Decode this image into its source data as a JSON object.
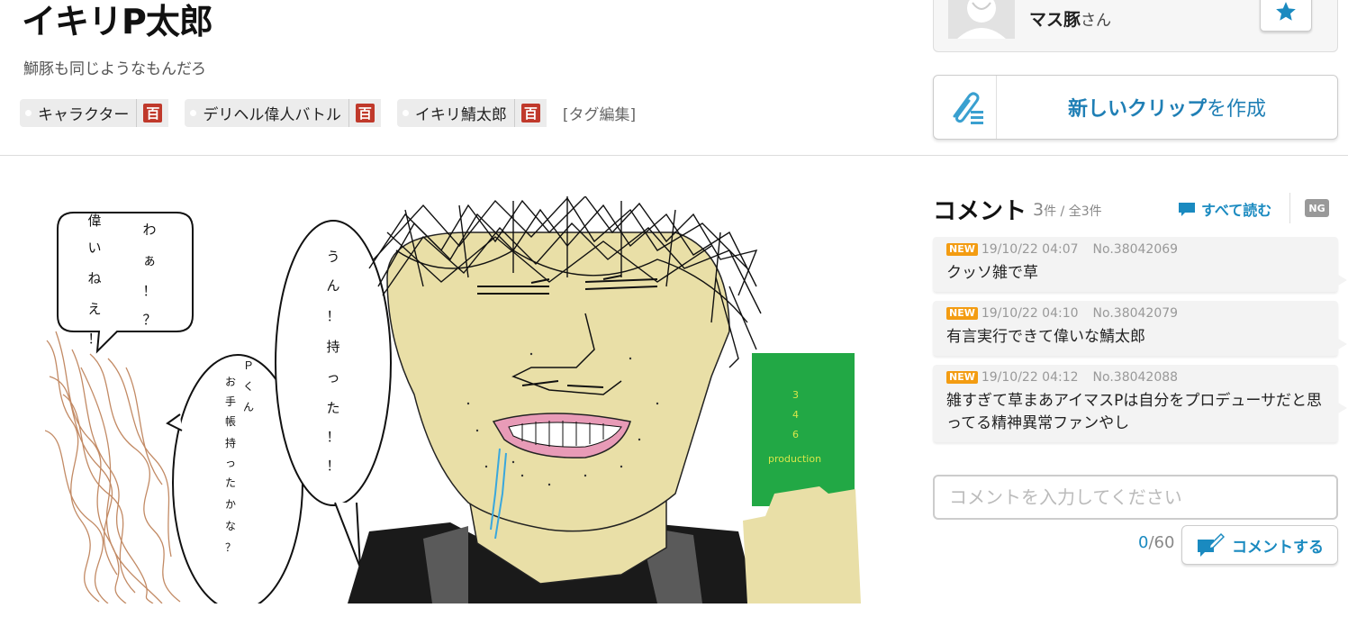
{
  "illust": {
    "title": "イキリP太郎",
    "caption": "鰤豚も同じようなもんだろ",
    "tags": [
      {
        "label": "キャラクター",
        "dic": "百"
      },
      {
        "label": "デリヘル偉人バトル",
        "dic": "百"
      },
      {
        "label": "イキリ鯖太郎",
        "dic": "百"
      }
    ],
    "tag_edit": "[タグ編集]"
  },
  "artwork": {
    "bubble_left_lines": [
      "偉",
      "い",
      "ね",
      "え",
      "！"
    ],
    "bubble_left_lines2": [
      "わ",
      "ぁ",
      "！",
      "？"
    ],
    "bubble_mid": [
      "Ｐ",
      "く",
      "ん",
      "お",
      "手",
      "帳",
      "持",
      "っ",
      "た",
      "か",
      "な",
      "？"
    ],
    "bubble_main": [
      "う",
      "ん",
      "！",
      "持",
      "っ",
      "た",
      "！",
      "！"
    ],
    "book_text": [
      "3",
      "4",
      "6",
      "production"
    ],
    "colors": {
      "skin": "#e9dfa7",
      "book": "#22a845"
    }
  },
  "user": {
    "name": "マス豚",
    "suffix": "さん"
  },
  "clip": {
    "bold": "新しいクリップ",
    "rest": "を作成"
  },
  "comments": {
    "title": "コメント",
    "count": "3",
    "count_unit": "件 / 全3件",
    "read_all": "すべて読む",
    "ng": "NG",
    "items": [
      {
        "badge": "NEW",
        "date": "19/10/22 04:07",
        "no": "No.38042069",
        "text": "クッソ雑で草"
      },
      {
        "badge": "NEW",
        "date": "19/10/22 04:10",
        "no": "No.38042079",
        "text": "有言実行できて偉いな鯖太郎"
      },
      {
        "badge": "NEW",
        "date": "19/10/22 04:12",
        "no": "No.38042088",
        "text": "雑すぎて草まあアイマスPは自分をプロデューサだと思ってる精神異常ファンやし"
      }
    ],
    "input_placeholder": "コメントを入力してください",
    "char_current": "0",
    "char_max": "/60",
    "submit_label": "コメントする"
  },
  "colors": {
    "accent": "#1a8ac0",
    "badge": "#f39c12",
    "dic": "#c0392b"
  }
}
